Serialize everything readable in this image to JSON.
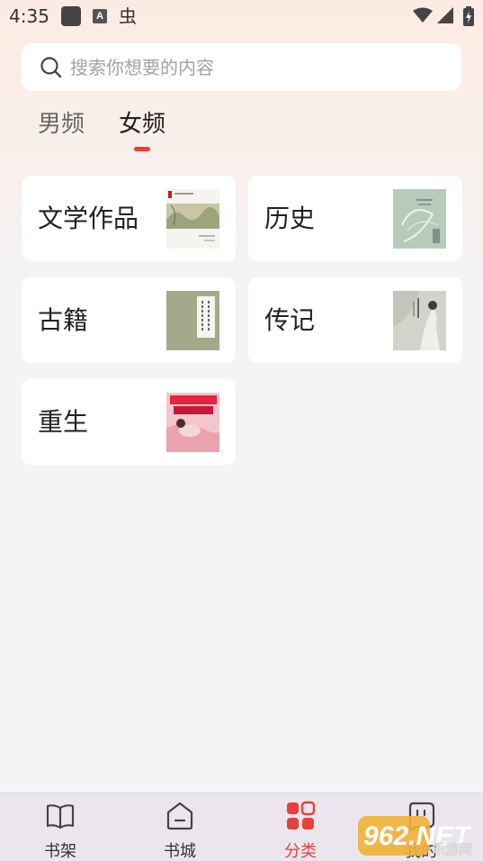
{
  "status_bar": {
    "time": "4:35",
    "a_icon": "A",
    "bug_icon": "虫"
  },
  "search": {
    "placeholder": "搜索你想要的内容",
    "value": ""
  },
  "tabs": [
    {
      "label": "男频",
      "active": false
    },
    {
      "label": "女频",
      "active": true
    }
  ],
  "categories": [
    {
      "label": "文学作品",
      "cover": "literature-cover"
    },
    {
      "label": "历史",
      "cover": "history-cover"
    },
    {
      "label": "古籍",
      "cover": "ancient-books-cover"
    },
    {
      "label": "传记",
      "cover": "biography-cover"
    },
    {
      "label": "重生",
      "cover": "rebirth-cover"
    }
  ],
  "bottom_nav": [
    {
      "label": "书架",
      "icon": "book-open-icon",
      "active": false
    },
    {
      "label": "书城",
      "icon": "store-icon",
      "active": false
    },
    {
      "label": "分类",
      "icon": "category-grid-icon",
      "active": true
    },
    {
      "label": "我的",
      "icon": "profile-icon",
      "active": false
    }
  ],
  "watermark": {
    "text": "962.NET",
    "subtext": "乐游网"
  },
  "colors": {
    "accent": "#e8413b",
    "background": "#f3f4f6",
    "card": "#ffffff",
    "nav_bar": "#ebe6ee"
  }
}
